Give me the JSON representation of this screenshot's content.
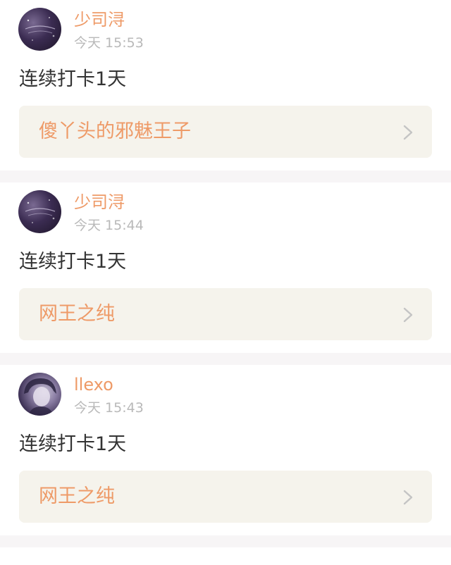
{
  "posts": [
    {
      "avatar_icon": "galaxy-avatar",
      "username": "少司浔",
      "time": "今天 15:53",
      "content": "连续打卡1天",
      "topic": "傻丫头的邪魅王子"
    },
    {
      "avatar_icon": "galaxy-avatar",
      "username": "少司浔",
      "time": "今天 15:44",
      "content": "连续打卡1天",
      "topic": "网王之纯"
    },
    {
      "avatar_icon": "person-avatar",
      "username": "llexo",
      "time": "今天 15:43",
      "content": "连续打卡1天",
      "topic": "网王之纯"
    }
  ],
  "colors": {
    "accent": "#ee9a67",
    "time": "#b9b9b9",
    "text": "#333333",
    "card_bg": "#f5f3ec",
    "separator": "#f7f5f6"
  },
  "icons": {
    "chevron": "chevron-right-icon"
  }
}
